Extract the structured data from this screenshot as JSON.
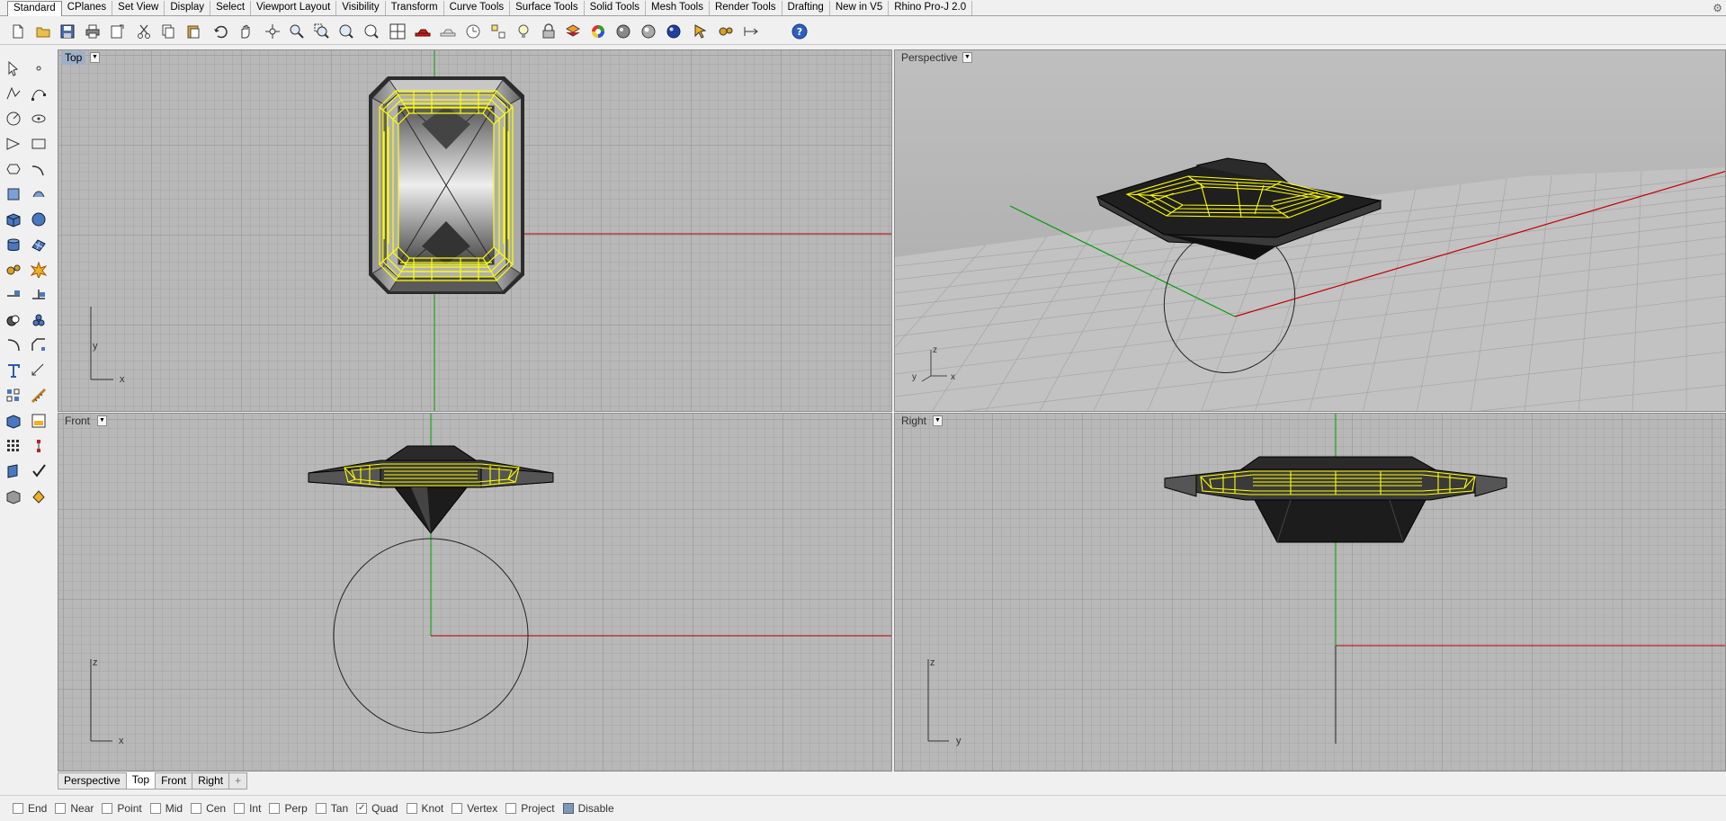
{
  "tabs": [
    "Standard",
    "CPlanes",
    "Set View",
    "Display",
    "Select",
    "Viewport Layout",
    "Visibility",
    "Transform",
    "Curve Tools",
    "Surface Tools",
    "Solid Tools",
    "Mesh Tools",
    "Render Tools",
    "Drafting",
    "New in V5",
    "Rhino Pro-J 2.0"
  ],
  "active_tab": "Standard",
  "toolbar_icons": [
    "new-file-icon",
    "open-icon",
    "save-icon",
    "print-icon",
    "import-icon",
    "cut-icon",
    "copy-icon",
    "paste-icon",
    "undo-icon",
    "pan-hand-icon",
    "rotate-view-icon",
    "zoom-dynamic-icon",
    "zoom-window-icon",
    "zoom-extents-icon",
    "zoom-selected-icon",
    "four-viewports-icon",
    "car-object-icon",
    "ghost-car-icon",
    "timer-icon",
    "object-properties-icon",
    "light-bulb-icon",
    "lock-icon",
    "layer-icon",
    "color-wheel-icon",
    "render-preview-sphere-icon",
    "shaded-sphere-icon",
    "rendered-sphere-icon",
    "select-arrow-icon",
    "gear-options-icon",
    "dimension-icon",
    "help-icon"
  ],
  "left_tool_icons": [
    "select-arrow-icon",
    "point-icon",
    "polyline-icon",
    "curve-icon",
    "circle-icon",
    "ellipse-icon",
    "arc-icon",
    "rectangle-icon",
    "polygon-icon",
    "freeform-curve-icon",
    "surface-corner-icon",
    "extrude-icon",
    "box-solid-icon",
    "solid-edit-icon",
    "cylinder-icon",
    "mesh-icon",
    "gear-settings-icon",
    "explode-icon",
    "split-icon",
    "trim-icon",
    "boolean-icon",
    "group-icon",
    "fillet-icon",
    "chamfer-icon",
    "text-icon",
    "dimension-icon",
    "align-icon",
    "measure-icon",
    "block-icon",
    "render-icon",
    "array-icon",
    "grip-icon",
    "analyze-icon",
    "check-icon",
    "layout-icon",
    "paint-bucket-icon"
  ],
  "viewports": {
    "top": {
      "title": "Top",
      "axis_v": "y",
      "axis_h": "x"
    },
    "perspective": {
      "title": "Perspective",
      "axis_v": "z",
      "axis_h": "x",
      "axis_d": "y"
    },
    "front": {
      "title": "Front",
      "axis_v": "z",
      "axis_h": "x"
    },
    "right": {
      "title": "Right",
      "axis_v": "z",
      "axis_h": "y"
    }
  },
  "active_viewport": "Top",
  "view_tabs": [
    "Perspective",
    "Top",
    "Front",
    "Right"
  ],
  "active_view_tab": "Top",
  "add_tab_glyph": "+",
  "osnap": [
    {
      "label": "End",
      "checked": false
    },
    {
      "label": "Near",
      "checked": false
    },
    {
      "label": "Point",
      "checked": false
    },
    {
      "label": "Mid",
      "checked": false
    },
    {
      "label": "Cen",
      "checked": false
    },
    {
      "label": "Int",
      "checked": false
    },
    {
      "label": "Perp",
      "checked": false
    },
    {
      "label": "Tan",
      "checked": false
    },
    {
      "label": "Quad",
      "checked": true
    },
    {
      "label": "Knot",
      "checked": false
    },
    {
      "label": "Vertex",
      "checked": false
    },
    {
      "label": "Project",
      "checked": false
    },
    {
      "label": "Disable",
      "checked": true
    }
  ],
  "colors": {
    "viewport_bg": "#b8b8b8",
    "grid_minor": "#a3a3a3",
    "x_axis": "#c00000",
    "y_axis": "#00a000",
    "wireframe": "#ffff00",
    "active_viewport_title": "#9db0c8"
  }
}
